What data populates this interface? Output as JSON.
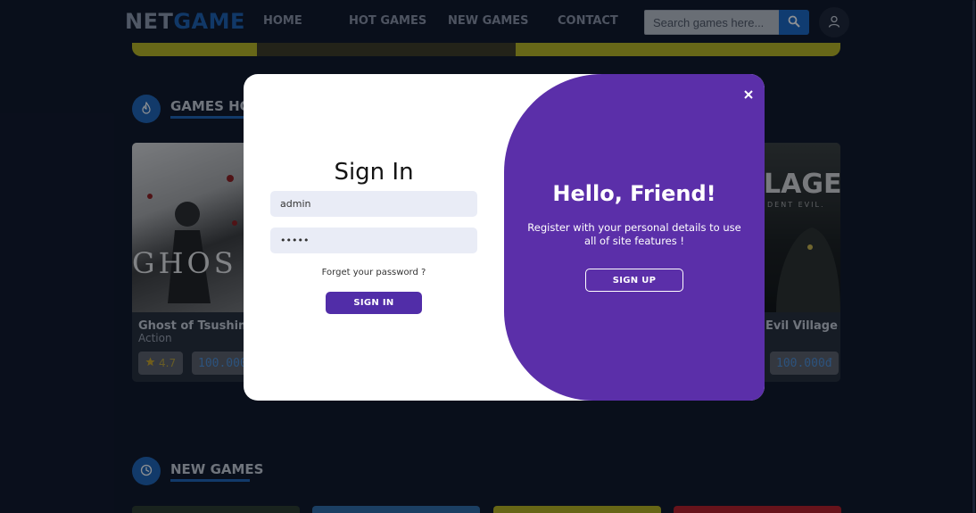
{
  "header": {
    "logo_part1": "NET",
    "logo_part2": "GAME",
    "nav": [
      "HOME",
      "HOT GAMES",
      "NEW GAMES",
      "CONTACT"
    ],
    "search_placeholder": "Search games here..."
  },
  "sections": {
    "hot_title": "GAMES HOT",
    "new_title": "NEW GAMES"
  },
  "cards": [
    {
      "title": "Ghost of Tsushima",
      "genre": "Action",
      "rating": "4.7",
      "price": "100.000"
    },
    {
      "title": "Evil Village",
      "price": "100.000đ"
    }
  ],
  "modal": {
    "signin_title": "Sign In",
    "username_value": "admin",
    "password_value": "•••••",
    "forgot_label": "Forget your password ?",
    "signin_label": "SIGN IN",
    "close_label": "×",
    "hello_title": "Hello, Friend!",
    "hello_text": "Register with your personal details to use all of site features !",
    "signup_label": "SIGN UP"
  },
  "colors": {
    "background": "#0e1525",
    "accent": "#1e63b4",
    "modal_purple": "#5b2fa9",
    "button_purple": "#512da8"
  },
  "icons": [
    "search-icon",
    "user-icon",
    "fire-icon",
    "clock-icon",
    "star-icon",
    "close-icon"
  ]
}
